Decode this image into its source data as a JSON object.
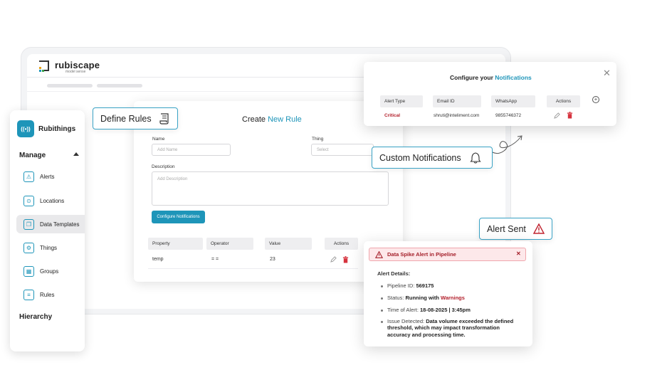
{
  "brand": {
    "name": "rubiscape",
    "tagline": "model sense"
  },
  "colors": {
    "accent": "#1e95b9",
    "danger": "#b3202c",
    "callout_border": "#3aa3c6"
  },
  "sidebar": {
    "app_name": "Rubithings",
    "section": "Manage",
    "items": [
      {
        "label": "Alerts",
        "icon": "alert-triangle-icon"
      },
      {
        "label": "Locations",
        "icon": "location-pin-icon"
      },
      {
        "label": "Data Templates",
        "icon": "copy-icon",
        "active": true
      },
      {
        "label": "Things",
        "icon": "chip-icon"
      },
      {
        "label": "Groups",
        "icon": "grid-icon"
      },
      {
        "label": "Rules",
        "icon": "scroll-icon"
      }
    ],
    "footer_section": "Hierarchy"
  },
  "callouts": {
    "define_rules": "Define Rules",
    "custom_notifications": "Custom Notifications",
    "alert_sent": "Alert Sent"
  },
  "rule_form": {
    "title_prefix": "Create",
    "title_accent": "New Rule",
    "name_label": "Name",
    "name_placeholder": "Add Name",
    "thing_label": "Thing",
    "thing_placeholder": "Select",
    "description_label": "Description",
    "description_placeholder": "Add Description",
    "configure_button": "Configure Notifications",
    "table": {
      "headers": [
        "Property",
        "Operator",
        "Value",
        "Actions"
      ],
      "rows": [
        {
          "property": "temp",
          "operator": "= =",
          "value": "23"
        }
      ]
    }
  },
  "notifications": {
    "title_prefix": "Configure your",
    "title_accent": "Notifications",
    "headers": [
      "Alert Type",
      "Email ID",
      "WhatsApp",
      "Actions"
    ],
    "rows": [
      {
        "alert_type": "Critical",
        "email": "shruti@inteliment.com",
        "whatsapp": "9855746372"
      }
    ]
  },
  "alert": {
    "banner": "Data Spike Alert in Pipeline",
    "details_title": "Alert Details:",
    "pipeline_label": "Pipeline ID:",
    "pipeline_value": "569175",
    "status_label": "Status:",
    "status_value": "Running with",
    "status_warn": "Warnings",
    "time_label": "Time of Alert:",
    "time_value": "18-08-2025 | 3:45pm",
    "issue_label": "Issue Detected:",
    "issue_value": "Data volume exceeded the defined threshold, which may impact transformation accuracy and processing time."
  }
}
